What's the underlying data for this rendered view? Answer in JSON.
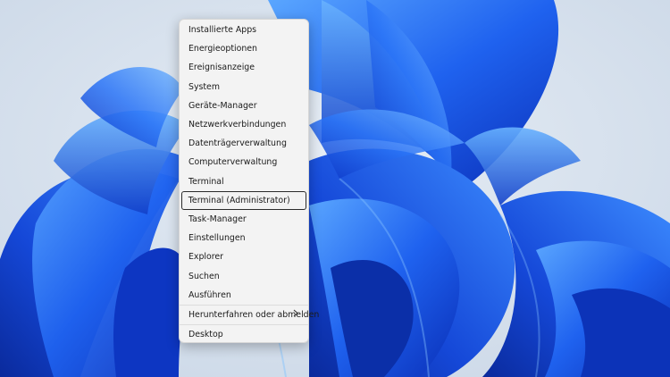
{
  "context_menu": {
    "items": [
      {
        "label": "Installierte Apps"
      },
      {
        "label": "Energieoptionen"
      },
      {
        "label": "Ereignisanzeige"
      },
      {
        "label": "System"
      },
      {
        "label": "Geräte-Manager"
      },
      {
        "label": "Netzwerkverbindungen"
      },
      {
        "label": "Datenträgerverwaltung"
      },
      {
        "label": "Computerverwaltung"
      },
      {
        "label": "Terminal"
      },
      {
        "label": "Terminal (Administrator)"
      },
      {
        "label": "Task-Manager"
      },
      {
        "label": "Einstellungen"
      },
      {
        "label": "Explorer"
      },
      {
        "label": "Suchen"
      },
      {
        "label": "Ausführen"
      },
      {
        "label": "Herunterfahren oder abmelden",
        "submenu_icon": "chevron-right-icon"
      },
      {
        "label": "Desktop"
      }
    ],
    "focused_item": "Terminal (Administrator)"
  },
  "colors": {
    "wallpaper_base": "#d9e3ee",
    "bloom_dark": "#0a2fb8",
    "bloom_mid": "#1f62ef",
    "bloom_light": "#4f9bff",
    "menu_background": "#f3f3f3"
  }
}
